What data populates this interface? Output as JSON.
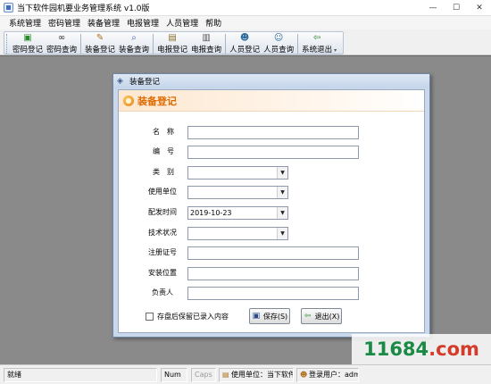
{
  "window": {
    "title": "当下软件园机要业务管理系统 v1.0版",
    "buttons": {
      "minimize": "—",
      "maximize": "☐",
      "close": "✕"
    }
  },
  "menubar": {
    "items": [
      "系统管理",
      "密码管理",
      "装备管理",
      "电报管理",
      "人员管理",
      "帮助"
    ]
  },
  "toolbar": {
    "buttons": [
      {
        "label": "密码登记",
        "icon": "key-register-icon"
      },
      {
        "label": "密码查询",
        "icon": "binoculars-icon"
      },
      {
        "label": "装备登记",
        "icon": "equipment-register-icon"
      },
      {
        "label": "装备查询",
        "icon": "equipment-search-icon"
      },
      {
        "label": "电报登记",
        "icon": "telegram-register-icon"
      },
      {
        "label": "电报查询",
        "icon": "telegram-search-icon"
      },
      {
        "label": "人员登记",
        "icon": "people-register-icon"
      },
      {
        "label": "人员查询",
        "icon": "people-search-icon"
      },
      {
        "label": "系统退出",
        "icon": "exit-icon"
      }
    ]
  },
  "dialog": {
    "title": "装备登记",
    "header": "装备登记",
    "fields": {
      "name": {
        "label": "名　称",
        "value": ""
      },
      "number": {
        "label": "编　号",
        "value": ""
      },
      "category": {
        "label": "类　别",
        "value": ""
      },
      "unit": {
        "label": "使用单位",
        "value": ""
      },
      "date": {
        "label": "配发时间",
        "value": "2019-10-23"
      },
      "status": {
        "label": "技术状况",
        "value": ""
      },
      "reg_no": {
        "label": "注册证号",
        "value": ""
      },
      "location": {
        "label": "安装位置",
        "value": ""
      },
      "person": {
        "label": "负责人",
        "value": ""
      }
    },
    "keep_checkbox": {
      "label": "存盘后保留已录入内容",
      "checked": false
    },
    "save_button": "保存(S)",
    "exit_button": "退出(X)"
  },
  "statusbar": {
    "ready": "就绪",
    "num": "Num",
    "caps": "Caps",
    "unit": "使用单位：当下软件园",
    "user": "登录用户：adm"
  },
  "watermark": {
    "text": "11684",
    "suffix": ".com"
  },
  "colors": {
    "accent": "#e06a00",
    "workspace": "#8a8a8a",
    "dialog_frame": "#c9d8ea",
    "watermark": "#1a8a45"
  }
}
